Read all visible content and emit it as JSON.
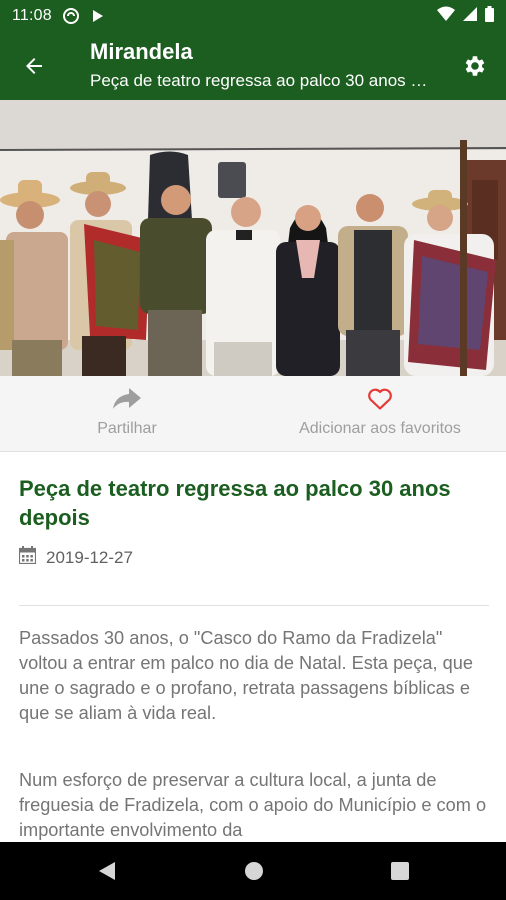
{
  "status_bar": {
    "time": "11:08"
  },
  "app_bar": {
    "title": "Mirandela",
    "subtitle": "Peça de teatro regressa ao palco 30 anos depois"
  },
  "actions": {
    "share_label": "Partilhar",
    "favorite_label": "Adicionar aos favoritos"
  },
  "article": {
    "headline": "Peça de teatro regressa ao palco 30 anos depois",
    "date": "2019-12-27",
    "paragraphs": [
      "Passados 30 anos, o \"Casco do Ramo da Fradizela\" voltou a entrar em palco no dia de Natal. Esta peça, que une o sagrado e o profano, retrata passagens bíblicas e que se aliam à vida real.",
      "Num esforço de preservar a cultura local, a junta de freguesia de Fradizela, com o apoio do Município e com o importante envolvimento da"
    ]
  },
  "colors": {
    "primary": "#1b5e20",
    "favorite_icon": "#e53935",
    "muted_text": "#757575"
  },
  "icons": {
    "back": "arrow-left-icon",
    "settings": "gear-icon",
    "share": "share-arrow-icon",
    "favorite": "heart-outline-icon",
    "date": "calendar-icon"
  }
}
